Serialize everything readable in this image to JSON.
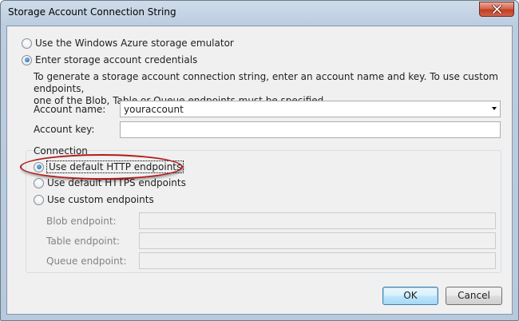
{
  "window": {
    "title": "Storage Account Connection String"
  },
  "mode": {
    "emulator_label": "Use the Windows Azure storage emulator",
    "credentials_label": "Enter storage account credentials",
    "selected": "credentials"
  },
  "description": {
    "line1": "To generate a storage account connection string, enter an account name and key.  To use custom endpoints,",
    "line2": "one of the Blob, Table or Queue endpoints must be specified."
  },
  "account": {
    "name_label": "Account name:",
    "name_value": "youraccount",
    "key_label": "Account key:",
    "key_value": ""
  },
  "connection": {
    "group_label": "Connection",
    "http_label": "Use default HTTP endpoints",
    "https_label": "Use default HTTPS endpoints",
    "custom_label": "Use custom endpoints",
    "selected": "http"
  },
  "endpoints": {
    "blob_label": "Blob endpoint:",
    "table_label": "Table endpoint:",
    "queue_label": "Queue endpoint:",
    "blob_value": "",
    "table_value": "",
    "queue_value": ""
  },
  "buttons": {
    "ok_label": "OK",
    "cancel_label": "Cancel"
  },
  "colors": {
    "highlight_ellipse": "#b31b1b",
    "window_frame": "#bccde0",
    "client_background": "#f0f0f0",
    "close_button": "#c13d22"
  },
  "icons": {
    "close": "close-icon"
  }
}
